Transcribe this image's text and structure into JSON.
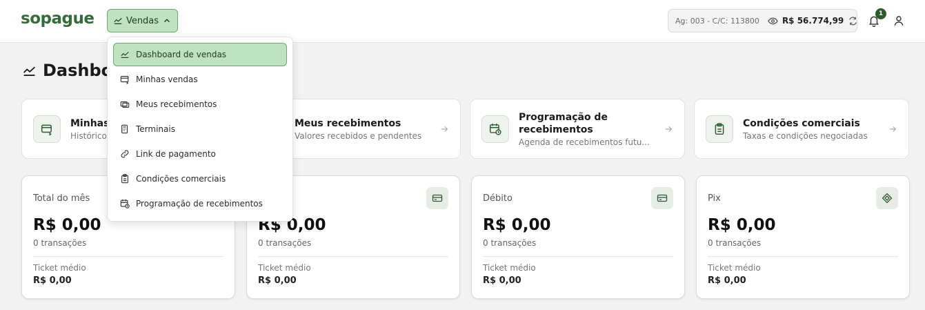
{
  "header": {
    "logo": "sopague",
    "menu_label": "Vendas",
    "account": "Ag: 003 - C/C: 113800",
    "balance": "R$ 56.774,99",
    "notification_count": "1"
  },
  "page": {
    "title": "Dashbo"
  },
  "nav_cards": [
    {
      "title": "Minhas",
      "subtitle": "Histórico"
    },
    {
      "title": "Meus recebimentos",
      "subtitle": "Valores recebidos e pendentes"
    },
    {
      "title": "Programação de recebimentos",
      "subtitle": "Agenda de recebimentos futu..."
    },
    {
      "title": "Condições comerciais",
      "subtitle": "Taxas e condições negociadas"
    }
  ],
  "stats": [
    {
      "label": "Total do mês",
      "amount": "R$ 0,00",
      "count": "0 transações",
      "ticket_label": "Ticket médio",
      "ticket_value": "R$ 0,00"
    },
    {
      "label": "",
      "amount": "R$ 0,00",
      "count": "0 transações",
      "ticket_label": "Ticket médio",
      "ticket_value": "R$ 0,00"
    },
    {
      "label": "Débito",
      "amount": "R$ 0,00",
      "count": "0 transações",
      "ticket_label": "Ticket médio",
      "ticket_value": "R$ 0,00"
    },
    {
      "label": "Pix",
      "amount": "R$ 0,00",
      "count": "0 transações",
      "ticket_label": "Ticket médio",
      "ticket_value": "R$ 0,00"
    }
  ],
  "dropdown": {
    "items": [
      {
        "label": "Dashboard de vendas",
        "icon": "chart-line-icon"
      },
      {
        "label": "Minhas vendas",
        "icon": "card-arrow-icon"
      },
      {
        "label": "Meus recebimentos",
        "icon": "cards-icon"
      },
      {
        "label": "Terminais",
        "icon": "terminal-icon"
      },
      {
        "label": "Link de pagamento",
        "icon": "link-icon"
      },
      {
        "label": "Condições comerciais",
        "icon": "clipboard-icon"
      },
      {
        "label": "Programação de recebimentos",
        "icon": "calendar-clock-icon"
      }
    ]
  },
  "colors": {
    "brand": "#356a3a",
    "accent_bg": "#bfe3bf",
    "accent_border": "#6da872"
  }
}
